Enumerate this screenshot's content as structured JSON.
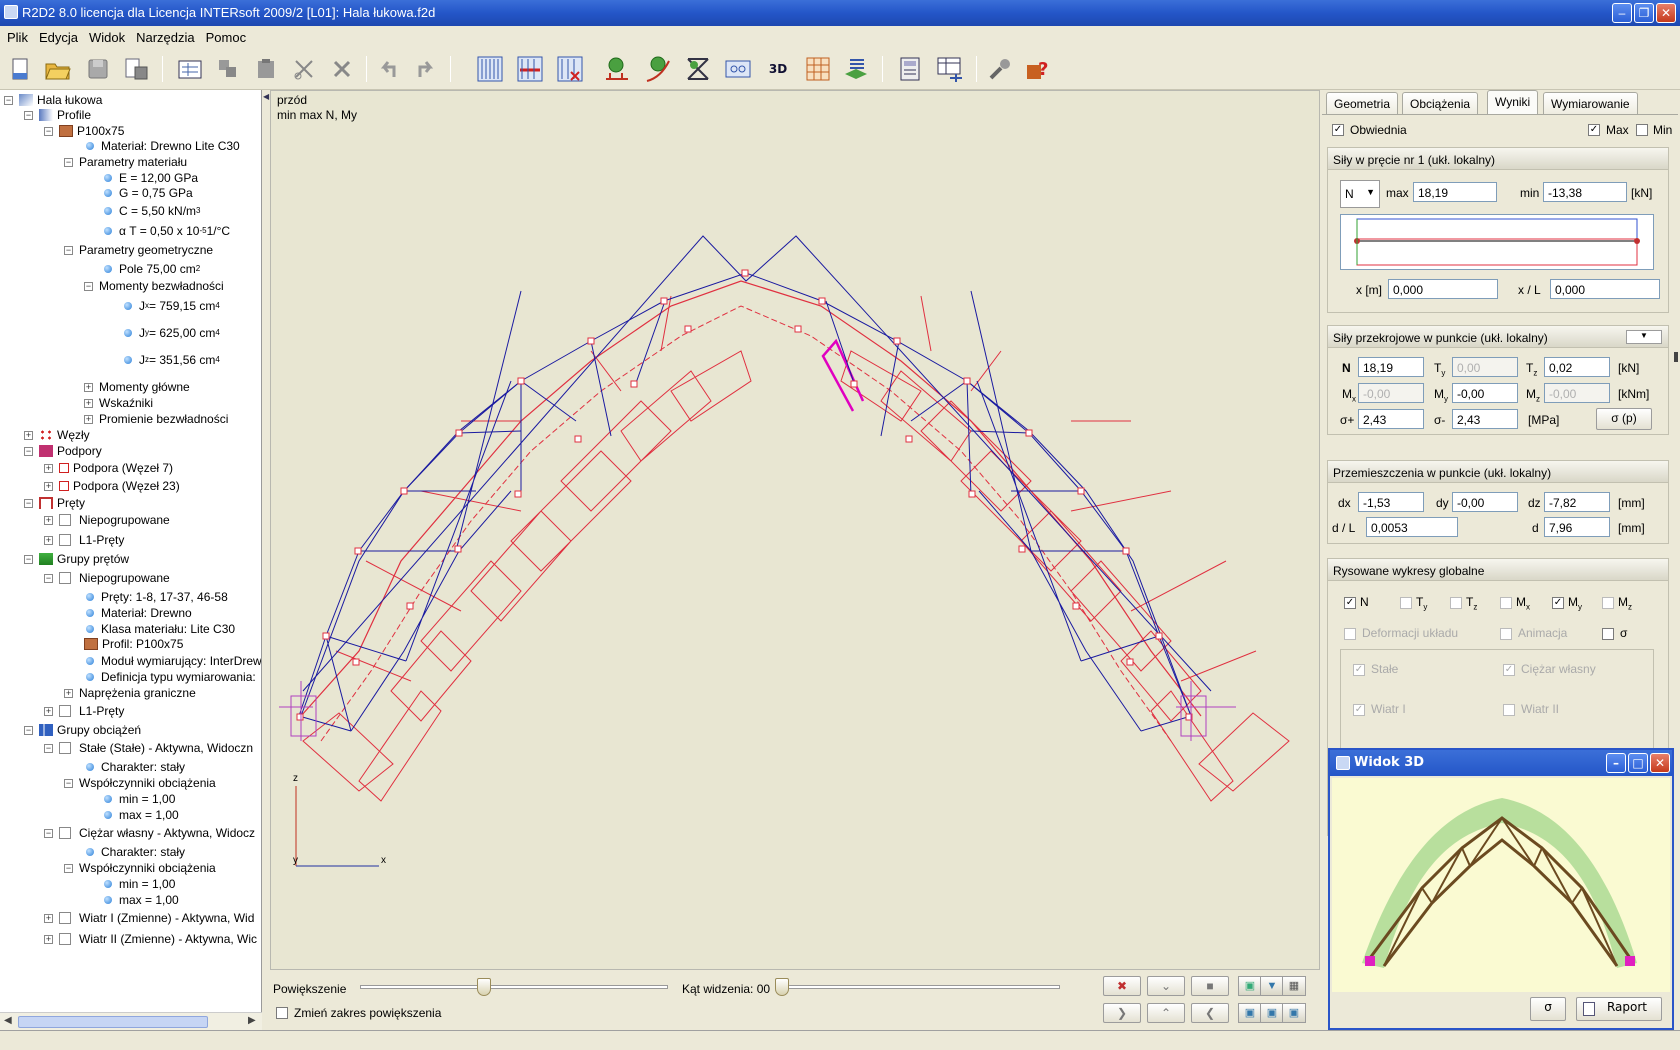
{
  "window": {
    "title": "R2D2 8.0 licencja dla Licencja INTERsoft 2009/2 [L01]: Hala łukowa.f2d"
  },
  "menu": [
    "Plik",
    "Edycja",
    "Widok",
    "Narzędzia",
    "Pomoc"
  ],
  "tree": {
    "root": "Hala łukowa",
    "profile": "Profile",
    "profile_name": "P100x75",
    "material": "Materiał: Drewno Lite C30",
    "mat_params": "Parametry materiału",
    "E": "E = 12,00 GPa",
    "G": "G = 0,75 GPa",
    "C": "C = 5,50 kN/m",
    "C_exp": "3",
    "aT": "α T = 0,50 x 10",
    "aT_exp": "-5",
    "aT_unit": " 1/°C",
    "geo_params": "Parametry geometryczne",
    "pole": "Pole 75,00 cm",
    "pole_exp": "2",
    "moments": "Momenty bezwładności",
    "jx_pre": "J",
    "jx_sub": "x",
    "jx_val": " = 759,15 cm",
    "jx_exp": "4",
    "jy_pre": "J",
    "jy_sub": "y",
    "jy_val": " = 625,00 cm",
    "jy_exp": "4",
    "jz_pre": "J",
    "jz_sub": "z",
    "jz_val": " = 351,56 cm",
    "jz_exp": "4",
    "main_moments": "Momenty główne",
    "indicators": "Wskaźniki",
    "radii": "Promienie bezwładności",
    "nodes": "Węzły",
    "supports": "Podpory",
    "support1": "Podpora (Węzeł 7)",
    "support2": "Podpora (Węzeł 23)",
    "bars": "Pręty",
    "ungrouped1": "Niepogrupowane",
    "l1_bars1": "L1-Pręty",
    "bar_groups": "Grupy prętów",
    "ungrouped2": "Niepogrupowane",
    "bars_list": "Pręty: 1-8, 17-37, 46-58",
    "material2": "Materiał: Drewno",
    "mat_class": "Klasa materiału: Lite C30",
    "profile2": "Profil: P100x75",
    "module": "Moduł wymiarujący: InterDrew",
    "def_type": "Definicja typu wymiarowania:",
    "stress_limits": "Naprężenia graniczne",
    "l1_bars2": "L1-Pręty",
    "load_groups": "Grupy obciążeń",
    "load1": "Stałe (Stałe) - Aktywna, Widoczn",
    "char1": "Charakter: stały",
    "coef1": "Współczynniki obciążenia",
    "min1": "min = 1,00",
    "max1": "max = 1,00",
    "load2": "Ciężar własny - Aktywna, Widocz",
    "char2": "Charakter: stały",
    "coef2": "Współczynniki obciążenia",
    "min2": "min = 1,00",
    "max2": "max = 1,00",
    "load3": "Wiatr I (Zmienne) - Aktywna, Wid",
    "load4": "Wiatr II (Zmienne) - Aktywna, Wic"
  },
  "viewport": {
    "view_name": "przód",
    "diagram": "min max N, My",
    "axis_z": "z",
    "axis_y": "y",
    "axis_x": "x"
  },
  "zoom": {
    "label": "Powiększenie",
    "zoom_level": 0.39,
    "angle_label": "Kąt widzenia: 00",
    "change_range": "Zmień zakres powiększenia"
  },
  "tabs": [
    "Geometria",
    "Obciążenia",
    "Wyniki",
    "Wymiarowanie"
  ],
  "results": {
    "envelope": "Obwiednia",
    "max_label": "Max",
    "min_label": "Min",
    "section1_title": "Siły w pręcie nr 1 (ukł. lokalny)",
    "force_select": "N",
    "max_text": "max",
    "max_val": "18,19",
    "min_text": "min",
    "min_val": "-13,38",
    "unit_kn": "[kN]",
    "x_label": "x [m]",
    "x_val": "0,000",
    "xl_label": "x / L",
    "xl_val": "0,000",
    "section2_title": "Siły przekrojowe w punkcie (ukł. lokalny)",
    "N_label": "N",
    "N_val": "18,19",
    "Ty_label": "T",
    "Ty_sub": "y",
    "Ty_val": "0,00",
    "Tz_label": "T",
    "Tz_sub": "z",
    "Tz_val": "0,02",
    "Mx_label": "M",
    "Mx_sub": "x",
    "Mx_val": "-0,00",
    "My_label": "M",
    "My_sub": "y",
    "My_val": "-0,00",
    "Mz_label": "M",
    "Mz_sub": "z",
    "Mz_val": "-0,00",
    "unit_knm": "[kNm]",
    "sp_label": "σ+",
    "sp_val": "2,43",
    "sm_label": "σ-",
    "sm_val": "2,43",
    "unit_mpa": "[MPa]",
    "sigma_p_btn": "σ (p)",
    "section3_title": "Przemieszczenia w punkcie (ukł. lokalny)",
    "dx_label": "dx",
    "dx_val": "-1,53",
    "dy_label": "dy",
    "dy_val": "-0,00",
    "dz_label": "dz",
    "dz_val": "-7,82",
    "unit_mm": "[mm]",
    "dl_label": "d / L",
    "dl_val": "0,0053",
    "d_label": "d",
    "d_val": "7,96",
    "unit_mm2": "[mm]",
    "section4_title": "Rysowane wykresy globalne",
    "g_N": "N",
    "g_Ty": "T",
    "g_Ty_sub": "y",
    "g_Tz": "T",
    "g_Tz_sub": "z",
    "g_Mx": "M",
    "g_Mx_sub": "x",
    "g_My": "M",
    "g_My_sub": "y",
    "g_Mz": "M",
    "g_Mz_sub": "z",
    "deform": "Deformacji układu",
    "anim": "Animacja",
    "sigma": "σ",
    "stale": "Stałe",
    "ciezar": "Ciężar własny",
    "wiatr1": "Wiatr I",
    "wiatr2": "Wiatr II"
  },
  "view3d": {
    "title": "Widok 3D",
    "sigma_btn": "σ",
    "report_btn": "Raport"
  },
  "colors": {
    "title_blue": "#2456c8",
    "canvas": "#e8e6d2",
    "truss_blue": "#1a1aa0",
    "diagram_red": "#e03040",
    "support_magenta": "#b040c0"
  }
}
